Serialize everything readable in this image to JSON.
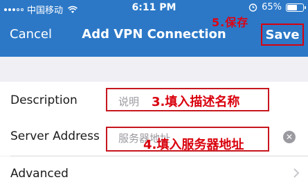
{
  "status": {
    "carrier": "中国移动",
    "time": "6:11 PM",
    "battery_percent": "65%",
    "battery_level": 0.65,
    "signal_bars": 5,
    "signal_filled": 3
  },
  "nav": {
    "cancel_label": "Cancel",
    "title": "Add VPN Connection",
    "save_label": "Save",
    "save_annotation": "5.保存"
  },
  "form": {
    "description": {
      "label": "Description",
      "placeholder": "说明",
      "annotation": "3.填入描述名称"
    },
    "server_address": {
      "label": "Server Address",
      "placeholder": "服务器地址",
      "annotation": "4.填入服务器地址",
      "clear_icon": "clear-icon"
    },
    "advanced": {
      "label": "Advanced",
      "chevron_icon": "chevron-right-icon"
    }
  },
  "colors": {
    "nav_bar": "#2c78c7",
    "annotation_red": "#d9000d",
    "background": "#efeff4"
  }
}
